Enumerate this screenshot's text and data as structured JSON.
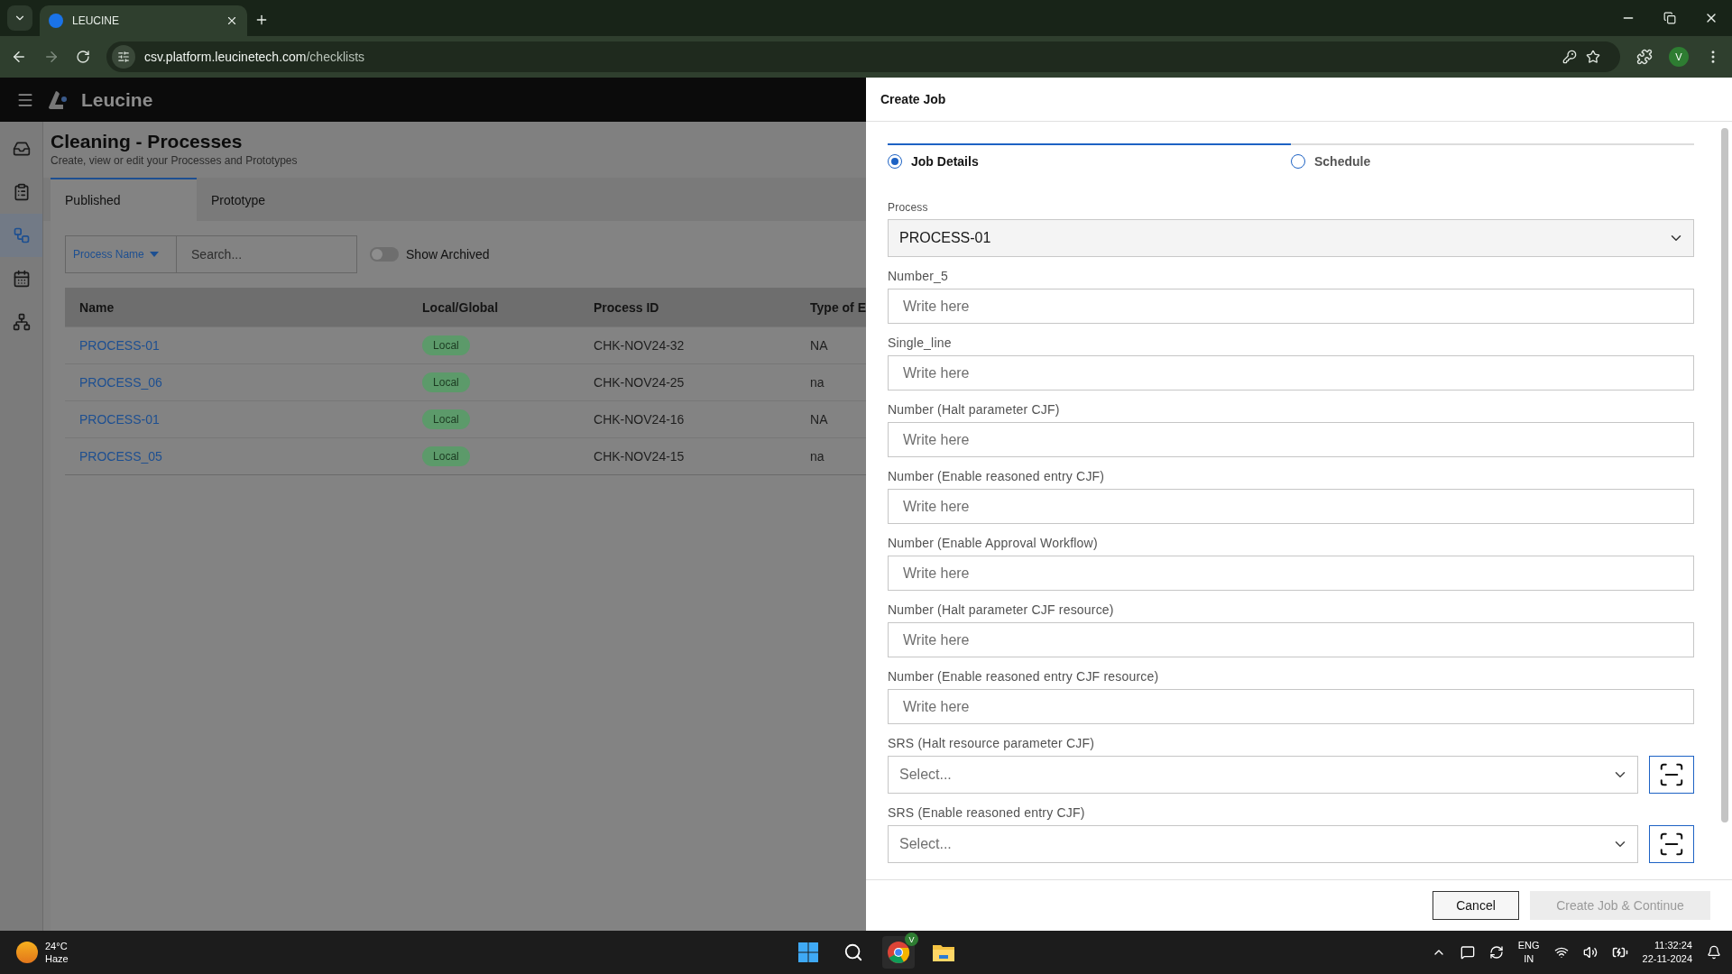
{
  "browser": {
    "tab_title": "LEUCINE",
    "url_host": "csv.platform.leucinetech.com",
    "url_path": "/checklists",
    "profile": "V"
  },
  "app": {
    "brand": "Leucine",
    "page_title": "Cleaning - Processes",
    "page_subtitle": "Create, view or edit your Processes and Prototypes",
    "sidebar": [
      {
        "kind": "inbox",
        "selected": false
      },
      {
        "kind": "checklist",
        "selected": false
      },
      {
        "kind": "flow",
        "selected": true
      },
      {
        "kind": "calendar",
        "selected": false
      },
      {
        "kind": "tree",
        "selected": false
      }
    ],
    "tabs": [
      {
        "label": "Published",
        "selected": true
      },
      {
        "label": "Prototype",
        "selected": false
      }
    ],
    "filter": {
      "field": "Process Name",
      "placeholder": "Search...",
      "archived_label": "Show Archived",
      "archived_on": false
    },
    "table": {
      "columns": [
        "Name",
        "Local/Global",
        "Process ID",
        "Type of E"
      ],
      "rows": [
        {
          "name": "PROCESS-01",
          "scope": "Local",
          "process_id": "CHK-NOV24-32",
          "type": "NA"
        },
        {
          "name": "PROCESS_06",
          "scope": "Local",
          "process_id": "CHK-NOV24-25",
          "type": "na"
        },
        {
          "name": "PROCESS-01",
          "scope": "Local",
          "process_id": "CHK-NOV24-16",
          "type": "NA"
        },
        {
          "name": "PROCESS_05",
          "scope": "Local",
          "process_id": "CHK-NOV24-15",
          "type": "na"
        }
      ]
    }
  },
  "drawer": {
    "title": "Create Job",
    "steps": [
      {
        "label": "Job Details",
        "selected": true
      },
      {
        "label": "Schedule",
        "selected": false
      }
    ],
    "process": {
      "label": "Process",
      "value": "PROCESS-01"
    },
    "fields": [
      {
        "kind": "text",
        "label": "Number_5",
        "placeholder": "Write here"
      },
      {
        "kind": "text",
        "label": "Single_line",
        "placeholder": "Write here"
      },
      {
        "kind": "text",
        "label": "Number (Halt parameter CJF)",
        "placeholder": "Write here"
      },
      {
        "kind": "text",
        "label": "Number (Enable reasoned entry CJF)",
        "placeholder": "Write here"
      },
      {
        "kind": "text",
        "label": "Number (Enable Approval Workflow)",
        "placeholder": "Write here"
      },
      {
        "kind": "text",
        "label": "Number (Halt parameter CJF resource)",
        "placeholder": "Write here"
      },
      {
        "kind": "text",
        "label": "Number (Enable reasoned entry CJF resource)",
        "placeholder": "Write here"
      },
      {
        "kind": "select",
        "label": "SRS (Halt resource parameter CJF)",
        "placeholder": "Select..."
      },
      {
        "kind": "select",
        "label": "SRS (Enable reasoned entry CJF)",
        "placeholder": "Select..."
      }
    ],
    "buttons": [
      {
        "label": "Cancel",
        "disabled": false
      },
      {
        "label": "Create Job & Continue",
        "disabled": true
      }
    ]
  },
  "taskbar": {
    "temperature": "24°C",
    "weather": "Haze",
    "lang": "ENG",
    "region": "IN",
    "time": "11:32:24",
    "date": "22-11-2024",
    "chrome_badge": "V"
  }
}
